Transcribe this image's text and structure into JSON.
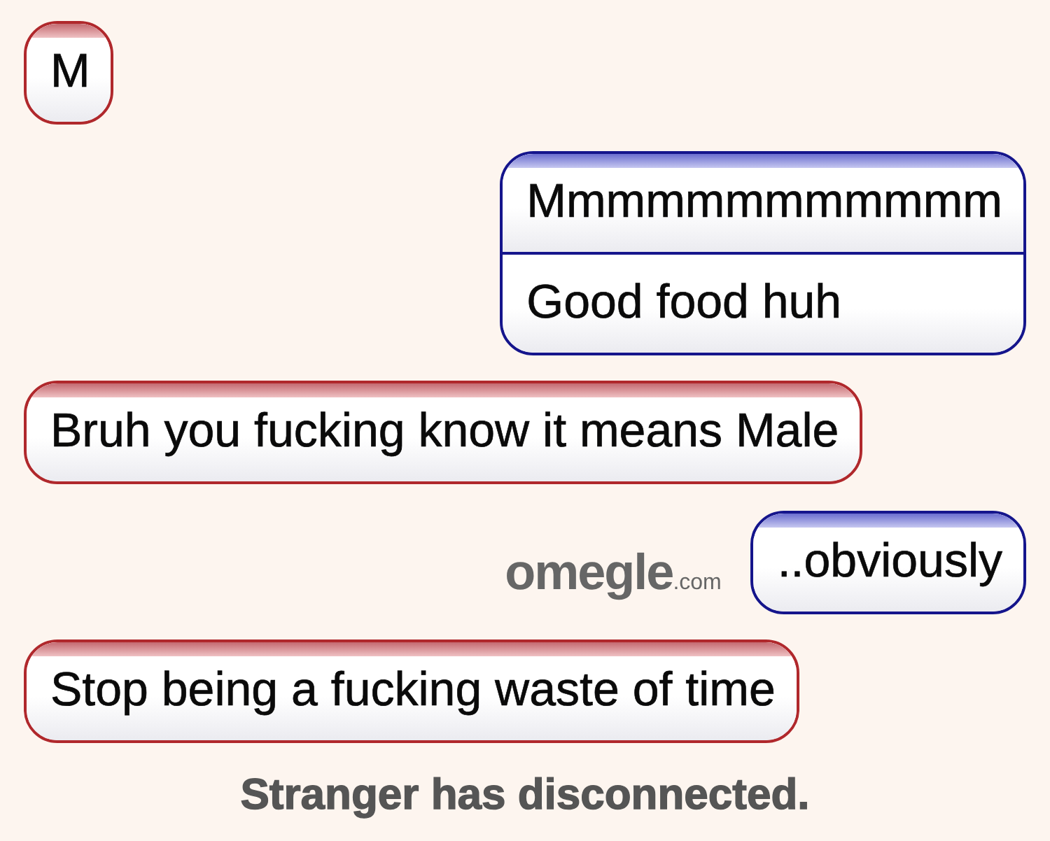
{
  "messages": [
    {
      "kind": "stranger",
      "lines": [
        "M"
      ]
    },
    {
      "kind": "you",
      "lines": [
        "Mmmmmmmmmmmm",
        "Good food huh"
      ]
    },
    {
      "kind": "stranger",
      "lines": [
        "Bruh you fucking know it means Male"
      ]
    },
    {
      "kind": "you",
      "lines": [
        "..obviously"
      ],
      "logo": {
        "text": "omegle",
        "suffix": ".com"
      }
    },
    {
      "kind": "stranger",
      "lines": [
        "Stop being a fucking waste of time"
      ]
    }
  ],
  "status": "Stranger has disconnected."
}
